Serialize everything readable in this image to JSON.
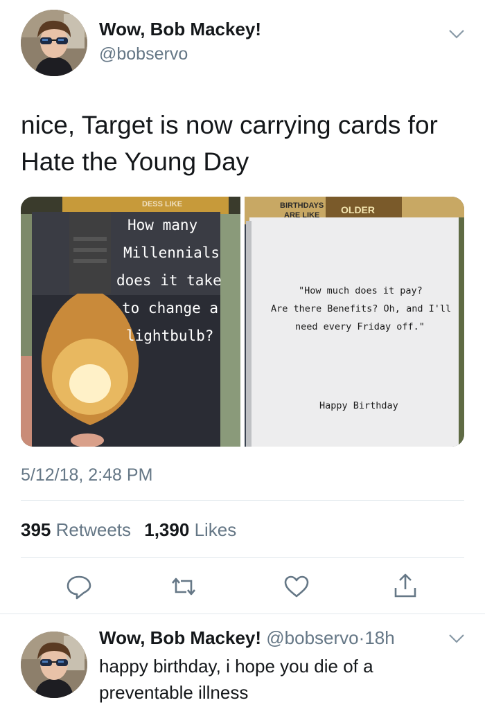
{
  "tweet": {
    "author_name": "Wow, Bob Mackey!",
    "author_handle": "@bobservo",
    "text_line1": "nice, Target is now carrying cards for",
    "text_line2": "Hate the Young Day",
    "timestamp": "5/12/18, 2:48 PM",
    "retweets_count": "395",
    "retweets_label": "Retweets",
    "likes_count": "1,390",
    "likes_label": "Likes"
  },
  "media": {
    "card_front_lines": [
      "How many",
      "Millennials",
      "does it take",
      "to change a",
      "lightbulb?"
    ],
    "card_inside_header_lines": [
      "BIRTHDAYS",
      "ARE LIKE"
    ],
    "card_inside_header_right": "OLDER",
    "card_inside_lines": [
      "\"How much does it pay?",
      "Are there Benefits? Oh, and I'll",
      "need every Friday off.\""
    ],
    "card_inside_signoff": "Happy Birthday"
  },
  "reply": {
    "author_name": "Wow, Bob Mackey!",
    "author_handle": "@bobservo",
    "separator": "·",
    "time": "18h",
    "text_line1": "happy birthday, i hope you die of a",
    "text_line2": "preventable illness"
  },
  "icons": {
    "reply": "comment-bubble-icon",
    "retweet": "retweet-arrows-icon",
    "like": "heart-icon",
    "share": "share-upload-icon",
    "menu": "chevron-down-icon"
  },
  "colors": {
    "text": "#14171a",
    "secondary": "#657786",
    "divider": "#e1e8ed"
  }
}
